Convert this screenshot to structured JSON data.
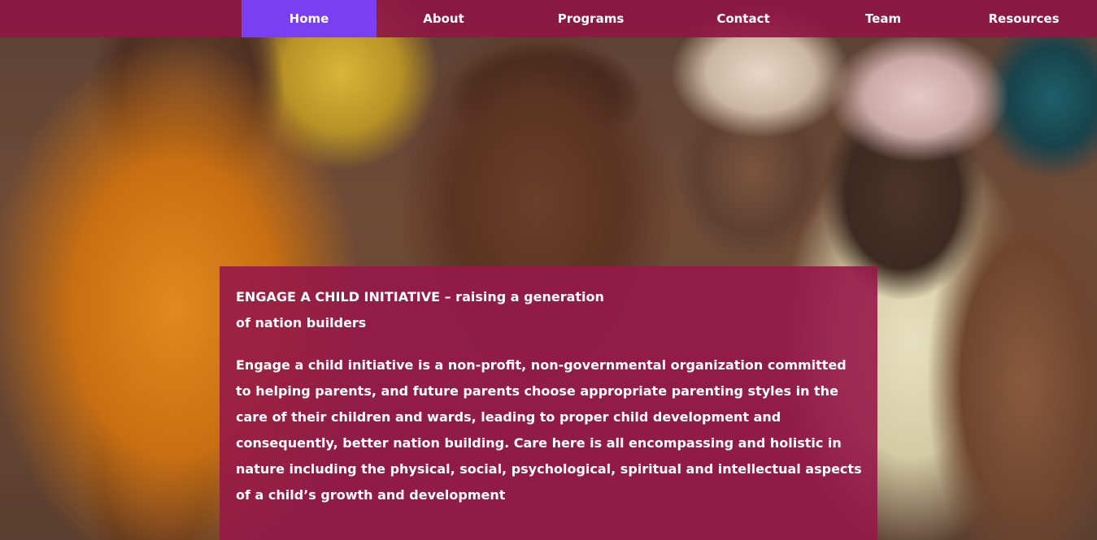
{
  "nav": {
    "items": [
      {
        "label": "Home",
        "active": true
      },
      {
        "label": "About",
        "active": false
      },
      {
        "label": "Programs",
        "active": false
      },
      {
        "label": "Contact",
        "active": false
      },
      {
        "label": "Team",
        "active": false
      },
      {
        "label": "Resources",
        "active": false
      }
    ],
    "background_color": "#8e1844",
    "active_color": "#7b3ff2"
  },
  "hero": {
    "title": "ENGAGE A CHILD INITIATIVE – raising a generation of nation builders",
    "body": "Engage a child initiative is a non-profit, non-governmental organization committed to helping parents, and future parents choose appropriate parenting styles in the care of their children and wards, leading to proper child development and consequently, better nation building. Care here is all encompassing and holistic in nature including the physical, social, psychological, spiritual and intellectual aspects of a child’s growth and development",
    "card_color": "#961848"
  }
}
